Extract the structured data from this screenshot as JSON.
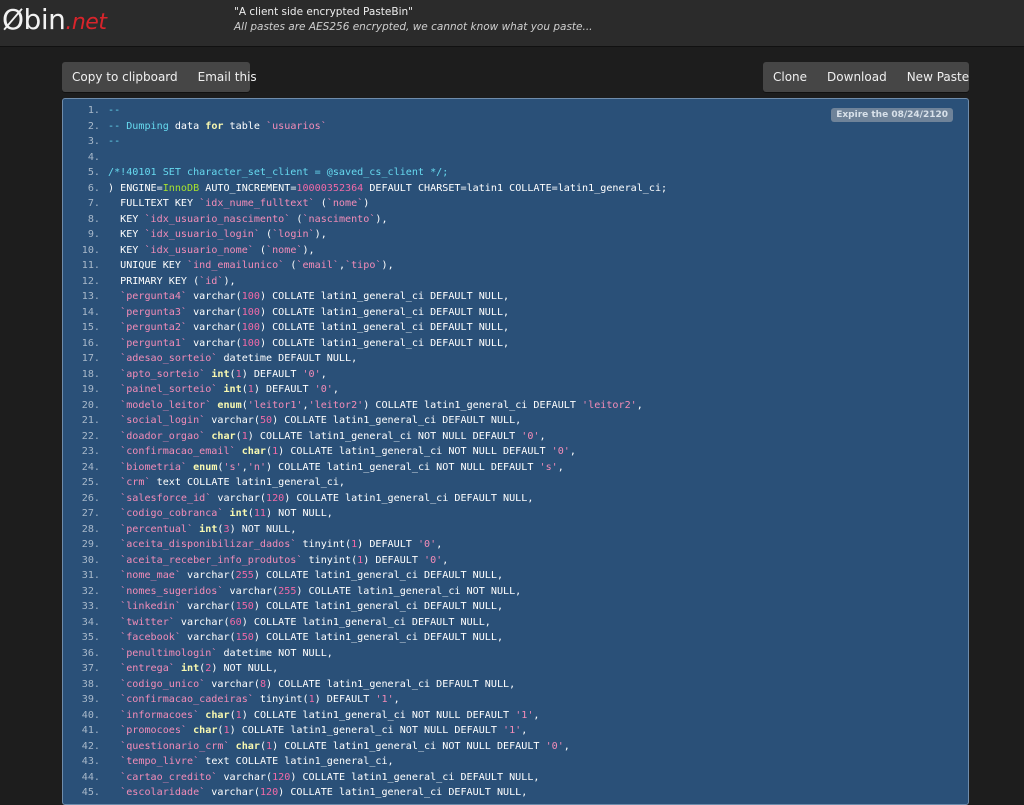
{
  "header": {
    "logo_main": "Øbin",
    "logo_tld": ".net",
    "tagline": "\"A client side encrypted PasteBin\"",
    "subtagline": "All pastes are AES256 encrypted, we cannot know what you paste..."
  },
  "toolbar_left": {
    "copy": "Copy to clipboard",
    "email": "Email this"
  },
  "toolbar_right": {
    "clone": "Clone",
    "download": "Download",
    "new_paste": "New Paste"
  },
  "paste": {
    "expire": "Expire the 08/24/2120",
    "lines": [
      [
        [
          "c",
          "--"
        ]
      ],
      [
        [
          "c",
          "-- Dumping "
        ],
        [
          "p",
          "data "
        ],
        [
          "kw",
          "for"
        ],
        [
          "p",
          " table "
        ],
        [
          "s",
          "`usuarios`"
        ]
      ],
      [
        [
          "c",
          "--"
        ]
      ],
      [
        [
          "p",
          ""
        ]
      ],
      [
        [
          "c",
          "/*!40101 SET character_set_client = @saved_cs_client */;"
        ]
      ],
      [
        [
          "p",
          ") ENGINE="
        ],
        [
          "t",
          "InnoDB"
        ],
        [
          "p",
          " AUTO_INCREMENT="
        ],
        [
          "n",
          "10000352364"
        ],
        [
          "p",
          " DEFAULT CHARSET=latin1 COLLATE=latin1_general_ci;"
        ]
      ],
      [
        [
          "p",
          "  FULLTEXT KEY "
        ],
        [
          "s",
          "`idx_nume_fulltext`"
        ],
        [
          "p",
          " ("
        ],
        [
          "s",
          "`nome`"
        ],
        [
          "p",
          ")"
        ]
      ],
      [
        [
          "p",
          "  KEY "
        ],
        [
          "s",
          "`idx_usuario_nascimento`"
        ],
        [
          "p",
          " ("
        ],
        [
          "s",
          "`nascimento`"
        ],
        [
          "p",
          "),"
        ]
      ],
      [
        [
          "p",
          "  KEY "
        ],
        [
          "s",
          "`idx_usuario_login`"
        ],
        [
          "p",
          " ("
        ],
        [
          "s",
          "`login`"
        ],
        [
          "p",
          "),"
        ]
      ],
      [
        [
          "p",
          "  KEY "
        ],
        [
          "s",
          "`idx_usuario_nome`"
        ],
        [
          "p",
          " ("
        ],
        [
          "s",
          "`nome`"
        ],
        [
          "p",
          "),"
        ]
      ],
      [
        [
          "p",
          "  UNIQUE KEY "
        ],
        [
          "s",
          "`ind_emailunico`"
        ],
        [
          "p",
          " ("
        ],
        [
          "s",
          "`email`"
        ],
        [
          "p",
          ","
        ],
        [
          "s",
          "`tipo`"
        ],
        [
          "p",
          "),"
        ]
      ],
      [
        [
          "p",
          "  PRIMARY KEY ("
        ],
        [
          "s",
          "`id`"
        ],
        [
          "p",
          "),"
        ]
      ],
      [
        [
          "p",
          "  "
        ],
        [
          "s",
          "`pergunta4`"
        ],
        [
          "p",
          " varchar("
        ],
        [
          "n",
          "100"
        ],
        [
          "p",
          ") COLLATE latin1_general_ci DEFAULT NULL,"
        ]
      ],
      [
        [
          "p",
          "  "
        ],
        [
          "s",
          "`pergunta3`"
        ],
        [
          "p",
          " varchar("
        ],
        [
          "n",
          "100"
        ],
        [
          "p",
          ") COLLATE latin1_general_ci DEFAULT NULL,"
        ]
      ],
      [
        [
          "p",
          "  "
        ],
        [
          "s",
          "`pergunta2`"
        ],
        [
          "p",
          " varchar("
        ],
        [
          "n",
          "100"
        ],
        [
          "p",
          ") COLLATE latin1_general_ci DEFAULT NULL,"
        ]
      ],
      [
        [
          "p",
          "  "
        ],
        [
          "s",
          "`pergunta1`"
        ],
        [
          "p",
          " varchar("
        ],
        [
          "n",
          "100"
        ],
        [
          "p",
          ") COLLATE latin1_general_ci DEFAULT NULL,"
        ]
      ],
      [
        [
          "p",
          "  "
        ],
        [
          "s",
          "`adesao_sorteio`"
        ],
        [
          "p",
          " datetime DEFAULT NULL,"
        ]
      ],
      [
        [
          "p",
          "  "
        ],
        [
          "s",
          "`apto_sorteio`"
        ],
        [
          "p",
          " "
        ],
        [
          "kw",
          "int"
        ],
        [
          "p",
          "("
        ],
        [
          "n",
          "1"
        ],
        [
          "p",
          ") DEFAULT "
        ],
        [
          "s",
          "'0'"
        ],
        [
          "p",
          ","
        ]
      ],
      [
        [
          "p",
          "  "
        ],
        [
          "s",
          "`painel_sorteio`"
        ],
        [
          "p",
          " "
        ],
        [
          "kw",
          "int"
        ],
        [
          "p",
          "("
        ],
        [
          "n",
          "1"
        ],
        [
          "p",
          ") DEFAULT "
        ],
        [
          "s",
          "'0'"
        ],
        [
          "p",
          ","
        ]
      ],
      [
        [
          "p",
          "  "
        ],
        [
          "s",
          "`modelo_leitor`"
        ],
        [
          "p",
          " "
        ],
        [
          "kw",
          "enum"
        ],
        [
          "p",
          "("
        ],
        [
          "s",
          "'leitor1'"
        ],
        [
          "p",
          ","
        ],
        [
          "s",
          "'leitor2'"
        ],
        [
          "p",
          ") COLLATE latin1_general_ci DEFAULT "
        ],
        [
          "s",
          "'leitor2'"
        ],
        [
          "p",
          ","
        ]
      ],
      [
        [
          "p",
          "  "
        ],
        [
          "s",
          "`social_login`"
        ],
        [
          "p",
          " varchar("
        ],
        [
          "n",
          "50"
        ],
        [
          "p",
          ") COLLATE latin1_general_ci DEFAULT NULL,"
        ]
      ],
      [
        [
          "p",
          "  "
        ],
        [
          "s",
          "`doador_orgao`"
        ],
        [
          "p",
          " "
        ],
        [
          "kw",
          "char"
        ],
        [
          "p",
          "("
        ],
        [
          "n",
          "1"
        ],
        [
          "p",
          ") COLLATE latin1_general_ci NOT NULL DEFAULT "
        ],
        [
          "s",
          "'0'"
        ],
        [
          "p",
          ","
        ]
      ],
      [
        [
          "p",
          "  "
        ],
        [
          "s",
          "`confirmacao_email`"
        ],
        [
          "p",
          " "
        ],
        [
          "kw",
          "char"
        ],
        [
          "p",
          "("
        ],
        [
          "n",
          "1"
        ],
        [
          "p",
          ") COLLATE latin1_general_ci NOT NULL DEFAULT "
        ],
        [
          "s",
          "'0'"
        ],
        [
          "p",
          ","
        ]
      ],
      [
        [
          "p",
          "  "
        ],
        [
          "s",
          "`biometria`"
        ],
        [
          "p",
          " "
        ],
        [
          "kw",
          "enum"
        ],
        [
          "p",
          "("
        ],
        [
          "s",
          "'s'"
        ],
        [
          "p",
          ","
        ],
        [
          "s",
          "'n'"
        ],
        [
          "p",
          ") COLLATE latin1_general_ci NOT NULL DEFAULT "
        ],
        [
          "s",
          "'s'"
        ],
        [
          "p",
          ","
        ]
      ],
      [
        [
          "p",
          "  "
        ],
        [
          "s",
          "`crm`"
        ],
        [
          "p",
          " text COLLATE latin1_general_ci,"
        ]
      ],
      [
        [
          "p",
          "  "
        ],
        [
          "s",
          "`salesforce_id`"
        ],
        [
          "p",
          " varchar("
        ],
        [
          "n",
          "120"
        ],
        [
          "p",
          ") COLLATE latin1_general_ci DEFAULT NULL,"
        ]
      ],
      [
        [
          "p",
          "  "
        ],
        [
          "s",
          "`codigo_cobranca`"
        ],
        [
          "p",
          " "
        ],
        [
          "kw",
          "int"
        ],
        [
          "p",
          "("
        ],
        [
          "n",
          "11"
        ],
        [
          "p",
          ") NOT NULL,"
        ]
      ],
      [
        [
          "p",
          "  "
        ],
        [
          "s",
          "`percentual`"
        ],
        [
          "p",
          " "
        ],
        [
          "kw",
          "int"
        ],
        [
          "p",
          "("
        ],
        [
          "n",
          "3"
        ],
        [
          "p",
          ") NOT NULL,"
        ]
      ],
      [
        [
          "p",
          "  "
        ],
        [
          "s",
          "`aceita_disponibilizar_dados`"
        ],
        [
          "p",
          " tinyint("
        ],
        [
          "n",
          "1"
        ],
        [
          "p",
          ") DEFAULT "
        ],
        [
          "s",
          "'0'"
        ],
        [
          "p",
          ","
        ]
      ],
      [
        [
          "p",
          "  "
        ],
        [
          "s",
          "`aceita_receber_info_produtos`"
        ],
        [
          "p",
          " tinyint("
        ],
        [
          "n",
          "1"
        ],
        [
          "p",
          ") DEFAULT "
        ],
        [
          "s",
          "'0'"
        ],
        [
          "p",
          ","
        ]
      ],
      [
        [
          "p",
          "  "
        ],
        [
          "s",
          "`nome_mae`"
        ],
        [
          "p",
          " varchar("
        ],
        [
          "n",
          "255"
        ],
        [
          "p",
          ") COLLATE latin1_general_ci DEFAULT NULL,"
        ]
      ],
      [
        [
          "p",
          "  "
        ],
        [
          "s",
          "`nomes_sugeridos`"
        ],
        [
          "p",
          " varchar("
        ],
        [
          "n",
          "255"
        ],
        [
          "p",
          ") COLLATE latin1_general_ci NOT NULL,"
        ]
      ],
      [
        [
          "p",
          "  "
        ],
        [
          "s",
          "`linkedin`"
        ],
        [
          "p",
          " varchar("
        ],
        [
          "n",
          "150"
        ],
        [
          "p",
          ") COLLATE latin1_general_ci DEFAULT NULL,"
        ]
      ],
      [
        [
          "p",
          "  "
        ],
        [
          "s",
          "`twitter`"
        ],
        [
          "p",
          " varchar("
        ],
        [
          "n",
          "60"
        ],
        [
          "p",
          ") COLLATE latin1_general_ci DEFAULT NULL,"
        ]
      ],
      [
        [
          "p",
          "  "
        ],
        [
          "s",
          "`facebook`"
        ],
        [
          "p",
          " varchar("
        ],
        [
          "n",
          "150"
        ],
        [
          "p",
          ") COLLATE latin1_general_ci DEFAULT NULL,"
        ]
      ],
      [
        [
          "p",
          "  "
        ],
        [
          "s",
          "`penultimologin`"
        ],
        [
          "p",
          " datetime NOT NULL,"
        ]
      ],
      [
        [
          "p",
          "  "
        ],
        [
          "s",
          "`entrega`"
        ],
        [
          "p",
          " "
        ],
        [
          "kw",
          "int"
        ],
        [
          "p",
          "("
        ],
        [
          "n",
          "2"
        ],
        [
          "p",
          ") NOT NULL,"
        ]
      ],
      [
        [
          "p",
          "  "
        ],
        [
          "s",
          "`codigo_unico`"
        ],
        [
          "p",
          " varchar("
        ],
        [
          "n",
          "8"
        ],
        [
          "p",
          ") COLLATE latin1_general_ci DEFAULT NULL,"
        ]
      ],
      [
        [
          "p",
          "  "
        ],
        [
          "s",
          "`confirmacao_cadeiras`"
        ],
        [
          "p",
          " tinyint("
        ],
        [
          "n",
          "1"
        ],
        [
          "p",
          ") DEFAULT "
        ],
        [
          "s",
          "'1'"
        ],
        [
          "p",
          ","
        ]
      ],
      [
        [
          "p",
          "  "
        ],
        [
          "s",
          "`informacoes`"
        ],
        [
          "p",
          " "
        ],
        [
          "kw",
          "char"
        ],
        [
          "p",
          "("
        ],
        [
          "n",
          "1"
        ],
        [
          "p",
          ") COLLATE latin1_general_ci NOT NULL DEFAULT "
        ],
        [
          "s",
          "'1'"
        ],
        [
          "p",
          ","
        ]
      ],
      [
        [
          "p",
          "  "
        ],
        [
          "s",
          "`promocoes`"
        ],
        [
          "p",
          " "
        ],
        [
          "kw",
          "char"
        ],
        [
          "p",
          "("
        ],
        [
          "n",
          "1"
        ],
        [
          "p",
          ") COLLATE latin1_general_ci NOT NULL DEFAULT "
        ],
        [
          "s",
          "'1'"
        ],
        [
          "p",
          ","
        ]
      ],
      [
        [
          "p",
          "  "
        ],
        [
          "s",
          "`questionario_crm`"
        ],
        [
          "p",
          " "
        ],
        [
          "kw",
          "char"
        ],
        [
          "p",
          "("
        ],
        [
          "n",
          "1"
        ],
        [
          "p",
          ") COLLATE latin1_general_ci NOT NULL DEFAULT "
        ],
        [
          "s",
          "'0'"
        ],
        [
          "p",
          ","
        ]
      ],
      [
        [
          "p",
          "  "
        ],
        [
          "s",
          "`tempo_livre`"
        ],
        [
          "p",
          " text COLLATE latin1_general_ci,"
        ]
      ],
      [
        [
          "p",
          "  "
        ],
        [
          "s",
          "`cartao_credito`"
        ],
        [
          "p",
          " varchar("
        ],
        [
          "n",
          "120"
        ],
        [
          "p",
          ") COLLATE latin1_general_ci DEFAULT NULL,"
        ]
      ],
      [
        [
          "p",
          "  "
        ],
        [
          "s",
          "`escolaridade`"
        ],
        [
          "p",
          " varchar("
        ],
        [
          "n",
          "120"
        ],
        [
          "p",
          ") COLLATE latin1_general_ci DEFAULT NULL,"
        ]
      ]
    ]
  }
}
